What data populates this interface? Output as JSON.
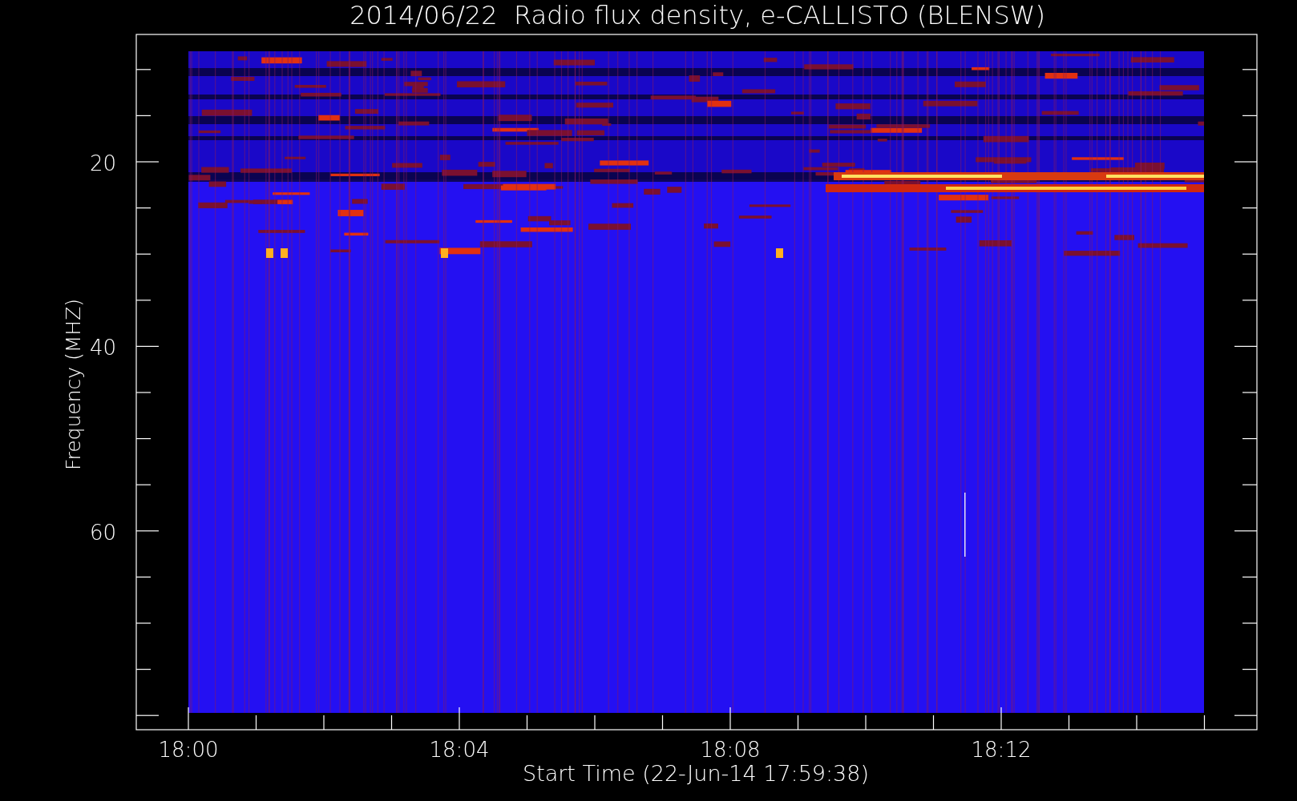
{
  "title": "2014/06/22  Radio flux density, e-CALLISTO (BLENSW)",
  "ylabel": "Frequency (MHZ)",
  "yticks": [
    "20",
    "40",
    "60"
  ],
  "xticks": [
    "18:00",
    "18:04",
    "18:08",
    "18:12"
  ],
  "xlabel": "Start Time (22-Jun-14 17:59:38)"
}
